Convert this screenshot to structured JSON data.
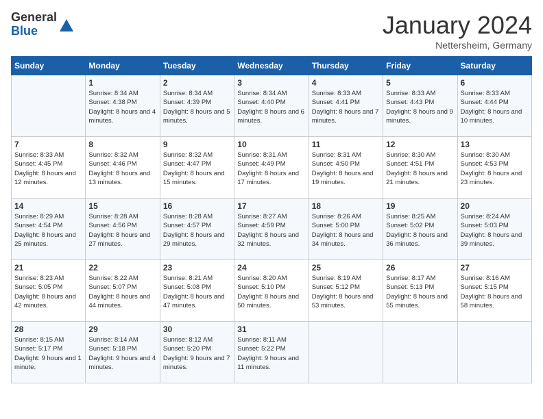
{
  "logo": {
    "general": "General",
    "blue": "Blue"
  },
  "title": "January 2024",
  "subtitle": "Nettersheim, Germany",
  "days_of_week": [
    "Sunday",
    "Monday",
    "Tuesday",
    "Wednesday",
    "Thursday",
    "Friday",
    "Saturday"
  ],
  "weeks": [
    [
      {
        "day": "",
        "sunrise": "",
        "sunset": "",
        "daylight": ""
      },
      {
        "day": "1",
        "sunrise": "Sunrise: 8:34 AM",
        "sunset": "Sunset: 4:38 PM",
        "daylight": "Daylight: 8 hours and 4 minutes."
      },
      {
        "day": "2",
        "sunrise": "Sunrise: 8:34 AM",
        "sunset": "Sunset: 4:39 PM",
        "daylight": "Daylight: 8 hours and 5 minutes."
      },
      {
        "day": "3",
        "sunrise": "Sunrise: 8:34 AM",
        "sunset": "Sunset: 4:40 PM",
        "daylight": "Daylight: 8 hours and 6 minutes."
      },
      {
        "day": "4",
        "sunrise": "Sunrise: 8:33 AM",
        "sunset": "Sunset: 4:41 PM",
        "daylight": "Daylight: 8 hours and 7 minutes."
      },
      {
        "day": "5",
        "sunrise": "Sunrise: 8:33 AM",
        "sunset": "Sunset: 4:43 PM",
        "daylight": "Daylight: 8 hours and 9 minutes."
      },
      {
        "day": "6",
        "sunrise": "Sunrise: 8:33 AM",
        "sunset": "Sunset: 4:44 PM",
        "daylight": "Daylight: 8 hours and 10 minutes."
      }
    ],
    [
      {
        "day": "7",
        "sunrise": "Sunrise: 8:33 AM",
        "sunset": "Sunset: 4:45 PM",
        "daylight": "Daylight: 8 hours and 12 minutes."
      },
      {
        "day": "8",
        "sunrise": "Sunrise: 8:32 AM",
        "sunset": "Sunset: 4:46 PM",
        "daylight": "Daylight: 8 hours and 13 minutes."
      },
      {
        "day": "9",
        "sunrise": "Sunrise: 8:32 AM",
        "sunset": "Sunset: 4:47 PM",
        "daylight": "Daylight: 8 hours and 15 minutes."
      },
      {
        "day": "10",
        "sunrise": "Sunrise: 8:31 AM",
        "sunset": "Sunset: 4:49 PM",
        "daylight": "Daylight: 8 hours and 17 minutes."
      },
      {
        "day": "11",
        "sunrise": "Sunrise: 8:31 AM",
        "sunset": "Sunset: 4:50 PM",
        "daylight": "Daylight: 8 hours and 19 minutes."
      },
      {
        "day": "12",
        "sunrise": "Sunrise: 8:30 AM",
        "sunset": "Sunset: 4:51 PM",
        "daylight": "Daylight: 8 hours and 21 minutes."
      },
      {
        "day": "13",
        "sunrise": "Sunrise: 8:30 AM",
        "sunset": "Sunset: 4:53 PM",
        "daylight": "Daylight: 8 hours and 23 minutes."
      }
    ],
    [
      {
        "day": "14",
        "sunrise": "Sunrise: 8:29 AM",
        "sunset": "Sunset: 4:54 PM",
        "daylight": "Daylight: 8 hours and 25 minutes."
      },
      {
        "day": "15",
        "sunrise": "Sunrise: 8:28 AM",
        "sunset": "Sunset: 4:56 PM",
        "daylight": "Daylight: 8 hours and 27 minutes."
      },
      {
        "day": "16",
        "sunrise": "Sunrise: 8:28 AM",
        "sunset": "Sunset: 4:57 PM",
        "daylight": "Daylight: 8 hours and 29 minutes."
      },
      {
        "day": "17",
        "sunrise": "Sunrise: 8:27 AM",
        "sunset": "Sunset: 4:59 PM",
        "daylight": "Daylight: 8 hours and 32 minutes."
      },
      {
        "day": "18",
        "sunrise": "Sunrise: 8:26 AM",
        "sunset": "Sunset: 5:00 PM",
        "daylight": "Daylight: 8 hours and 34 minutes."
      },
      {
        "day": "19",
        "sunrise": "Sunrise: 8:25 AM",
        "sunset": "Sunset: 5:02 PM",
        "daylight": "Daylight: 8 hours and 36 minutes."
      },
      {
        "day": "20",
        "sunrise": "Sunrise: 8:24 AM",
        "sunset": "Sunset: 5:03 PM",
        "daylight": "Daylight: 8 hours and 39 minutes."
      }
    ],
    [
      {
        "day": "21",
        "sunrise": "Sunrise: 8:23 AM",
        "sunset": "Sunset: 5:05 PM",
        "daylight": "Daylight: 8 hours and 42 minutes."
      },
      {
        "day": "22",
        "sunrise": "Sunrise: 8:22 AM",
        "sunset": "Sunset: 5:07 PM",
        "daylight": "Daylight: 8 hours and 44 minutes."
      },
      {
        "day": "23",
        "sunrise": "Sunrise: 8:21 AM",
        "sunset": "Sunset: 5:08 PM",
        "daylight": "Daylight: 8 hours and 47 minutes."
      },
      {
        "day": "24",
        "sunrise": "Sunrise: 8:20 AM",
        "sunset": "Sunset: 5:10 PM",
        "daylight": "Daylight: 8 hours and 50 minutes."
      },
      {
        "day": "25",
        "sunrise": "Sunrise: 8:19 AM",
        "sunset": "Sunset: 5:12 PM",
        "daylight": "Daylight: 8 hours and 53 minutes."
      },
      {
        "day": "26",
        "sunrise": "Sunrise: 8:17 AM",
        "sunset": "Sunset: 5:13 PM",
        "daylight": "Daylight: 8 hours and 55 minutes."
      },
      {
        "day": "27",
        "sunrise": "Sunrise: 8:16 AM",
        "sunset": "Sunset: 5:15 PM",
        "daylight": "Daylight: 8 hours and 58 minutes."
      }
    ],
    [
      {
        "day": "28",
        "sunrise": "Sunrise: 8:15 AM",
        "sunset": "Sunset: 5:17 PM",
        "daylight": "Daylight: 9 hours and 1 minute."
      },
      {
        "day": "29",
        "sunrise": "Sunrise: 8:14 AM",
        "sunset": "Sunset: 5:18 PM",
        "daylight": "Daylight: 9 hours and 4 minutes."
      },
      {
        "day": "30",
        "sunrise": "Sunrise: 8:12 AM",
        "sunset": "Sunset: 5:20 PM",
        "daylight": "Daylight: 9 hours and 7 minutes."
      },
      {
        "day": "31",
        "sunrise": "Sunrise: 8:11 AM",
        "sunset": "Sunset: 5:22 PM",
        "daylight": "Daylight: 9 hours and 11 minutes."
      },
      {
        "day": "",
        "sunrise": "",
        "sunset": "",
        "daylight": ""
      },
      {
        "day": "",
        "sunrise": "",
        "sunset": "",
        "daylight": ""
      },
      {
        "day": "",
        "sunrise": "",
        "sunset": "",
        "daylight": ""
      }
    ]
  ]
}
